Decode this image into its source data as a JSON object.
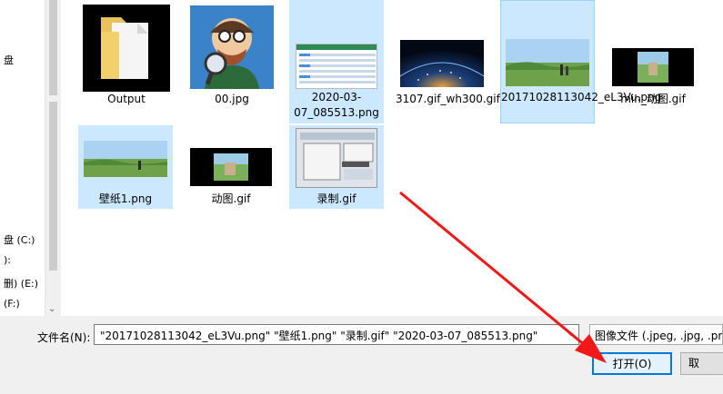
{
  "nav": {
    "items": [
      {
        "label": "盘 (C:)"
      },
      {
        "label": "):"
      },
      {
        "label": "删) (E:)"
      },
      {
        "label": "(F:)"
      }
    ],
    "top_fragment": "盘"
  },
  "files": [
    {
      "name": "Output",
      "selected": false
    },
    {
      "name": "00.jpg",
      "selected": false
    },
    {
      "name": "2020-03-07_085513.png",
      "selected": true
    },
    {
      "name": "3107.gif_wh300.gif",
      "selected": false
    },
    {
      "name": "20171028113042_eL3Vu.png",
      "selected": true
    },
    {
      "name": "min_动图.gif",
      "selected": false
    },
    {
      "name": "壁纸1.png",
      "selected": true
    },
    {
      "name": "动图.gif",
      "selected": false
    },
    {
      "name": "录制.gif",
      "selected": true
    }
  ],
  "bottom": {
    "filename_label": "文件名(N):",
    "filename_value": "\"20171028113042_eL3Vu.png\" \"壁纸1.png\" \"录制.gif\" \"2020-03-07_085513.png\"",
    "filetype_value": "图像文件 (.jpeg, .jpg, .pn",
    "open_label": "打开(O)",
    "cancel_label": "取"
  },
  "colors": {
    "selection": "#cce8ff",
    "accent": "#0078d7",
    "annotation_arrow": "#f21818"
  }
}
